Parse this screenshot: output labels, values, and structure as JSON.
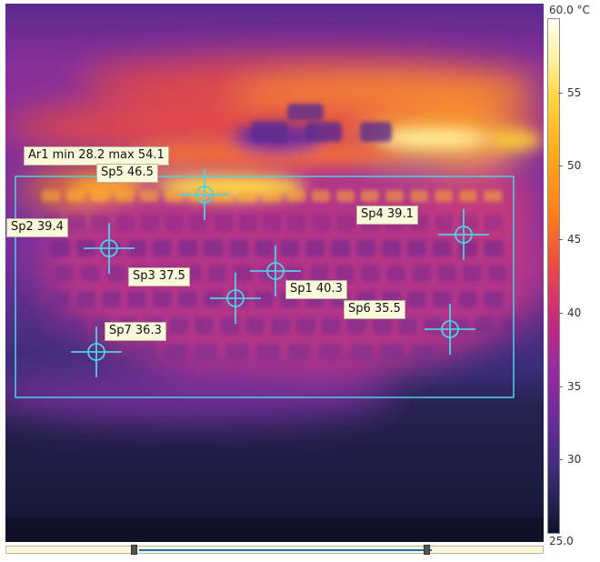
{
  "area": {
    "label": "Ar1 min 28.2 max 54.1",
    "min": 28.2,
    "max": 54.1
  },
  "spots": [
    {
      "id": "sp1",
      "label": "Sp1 40.3",
      "value": 40.3
    },
    {
      "id": "sp2",
      "label": "Sp2 39.4",
      "value": 39.4
    },
    {
      "id": "sp3",
      "label": "Sp3 37.5",
      "value": 37.5
    },
    {
      "id": "sp4",
      "label": "Sp4 39.1",
      "value": 39.1
    },
    {
      "id": "sp5",
      "label": "Sp5 46.5",
      "value": 46.5
    },
    {
      "id": "sp6",
      "label": "Sp6 35.5",
      "value": 35.5
    },
    {
      "id": "sp7",
      "label": "Sp7 36.3",
      "value": 36.3
    }
  ],
  "colorbar": {
    "max_label": "60.0 °C",
    "min_label": "25.0",
    "ticks": [
      "55",
      "50",
      "45",
      "40",
      "35",
      "30"
    ],
    "tick_values": [
      55,
      50,
      45,
      40,
      35,
      30
    ],
    "min": 25.0,
    "max": 60.0
  },
  "colors": {
    "marker": "#4fd0e6",
    "label_bg": "#fbf8dc",
    "cold": "#15183a",
    "hot": "#fff0a0"
  }
}
